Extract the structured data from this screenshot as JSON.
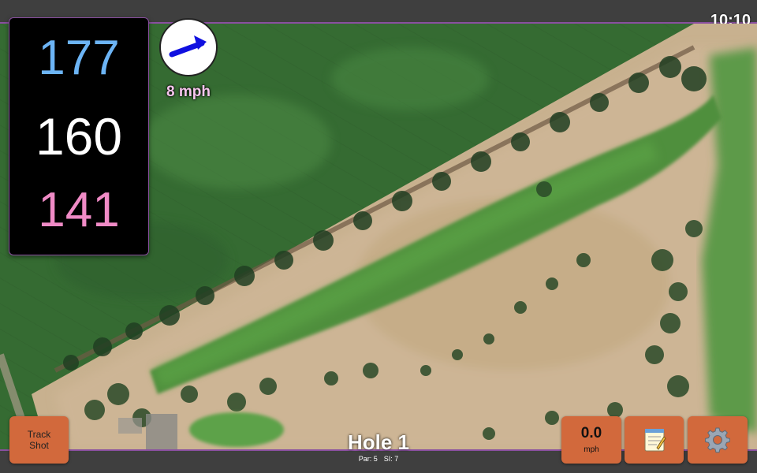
{
  "status": {
    "time": "10:10"
  },
  "distances": {
    "back": "177",
    "center": "160",
    "front": "141",
    "colors": {
      "back": "#6cb4f5",
      "center": "#ffffff",
      "front": "#f08bc6"
    }
  },
  "wind": {
    "speed": "8 mph",
    "icon": "wind-direction-arrow-icon",
    "arrow_color": "#1010e0"
  },
  "hole": {
    "title": "Hole 1",
    "par": "Par: 5",
    "si": "SI: 7"
  },
  "buttons": {
    "track_shot": "Track\nShot",
    "speed_value": "0.0",
    "speed_unit": "mph",
    "notes_icon": "notepad-icon",
    "settings_icon": "gear-icon",
    "color": "#d2693c"
  },
  "theme": {
    "bar": "#3f3f3f",
    "accent": "#8a4fa0"
  }
}
